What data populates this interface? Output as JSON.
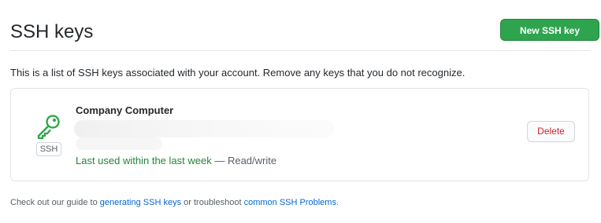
{
  "header": {
    "title": "SSH keys",
    "new_key_button": "New SSH key"
  },
  "description": "This is a list of SSH keys associated with your account. Remove any keys that you do not recognize.",
  "key": {
    "title": "Company Computer",
    "type_label": "SSH",
    "last_used": "Last used within the last week",
    "separator": " — ",
    "access": "Read/write",
    "delete_button": "Delete",
    "icon": "key-icon"
  },
  "footer": {
    "prefix": "Check out our guide to ",
    "link1": "generating SSH keys",
    "middle": " or troubleshoot ",
    "link2": "common SSH Problems",
    "suffix": "."
  },
  "colors": {
    "primary_button": "#2ea44f",
    "success_text": "#22863a",
    "danger_text": "#cb2431",
    "link": "#0366d6"
  }
}
